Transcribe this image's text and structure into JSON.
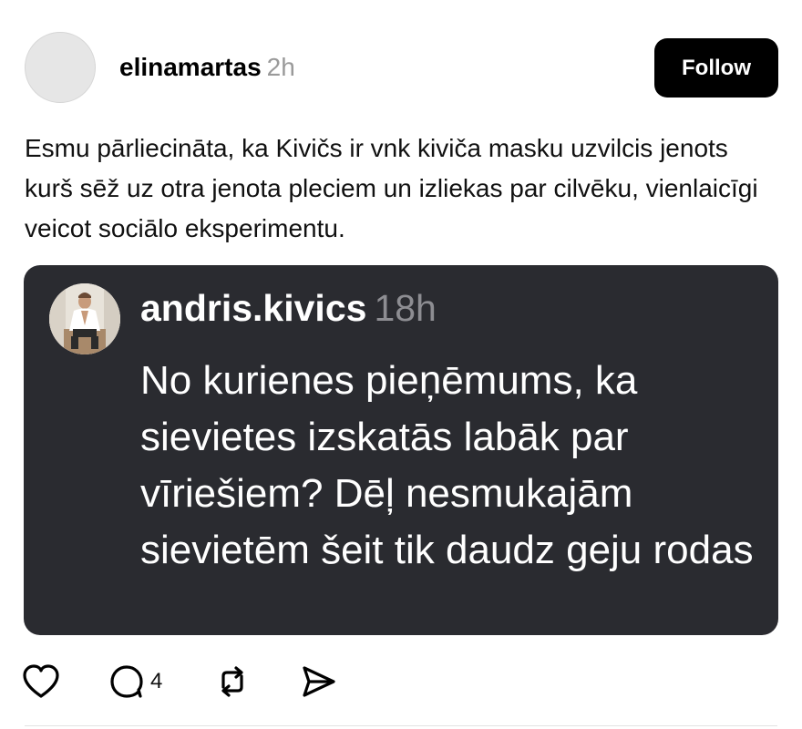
{
  "post": {
    "username": "elinamartas",
    "time": "2h",
    "follow_label": "Follow",
    "text": "Esmu pārliecināta, ka Kivičs ir vnk kiviča masku uzvilcis jenots kurš sēž uz otra jenota pleciem un izliekas par cilvēku, vienlaicīgi veicot sociālo eksperimentu."
  },
  "quoted": {
    "username": "andris.kivics",
    "time": "18h",
    "text": "No kurienes pieņēmums, ka sievietes izskatās labāk par vīriešiem? Dēļ nesmukajām sievietēm šeit tik daudz geju rodas"
  },
  "actions": {
    "like_icon": "heart-icon",
    "comment_icon": "comment-icon",
    "comment_count": "4",
    "repost_icon": "repost-icon",
    "share_icon": "send-icon"
  },
  "colors": {
    "follow_bg": "#000000",
    "quote_bg": "#2a2b30",
    "muted": "#9a9a9a"
  }
}
